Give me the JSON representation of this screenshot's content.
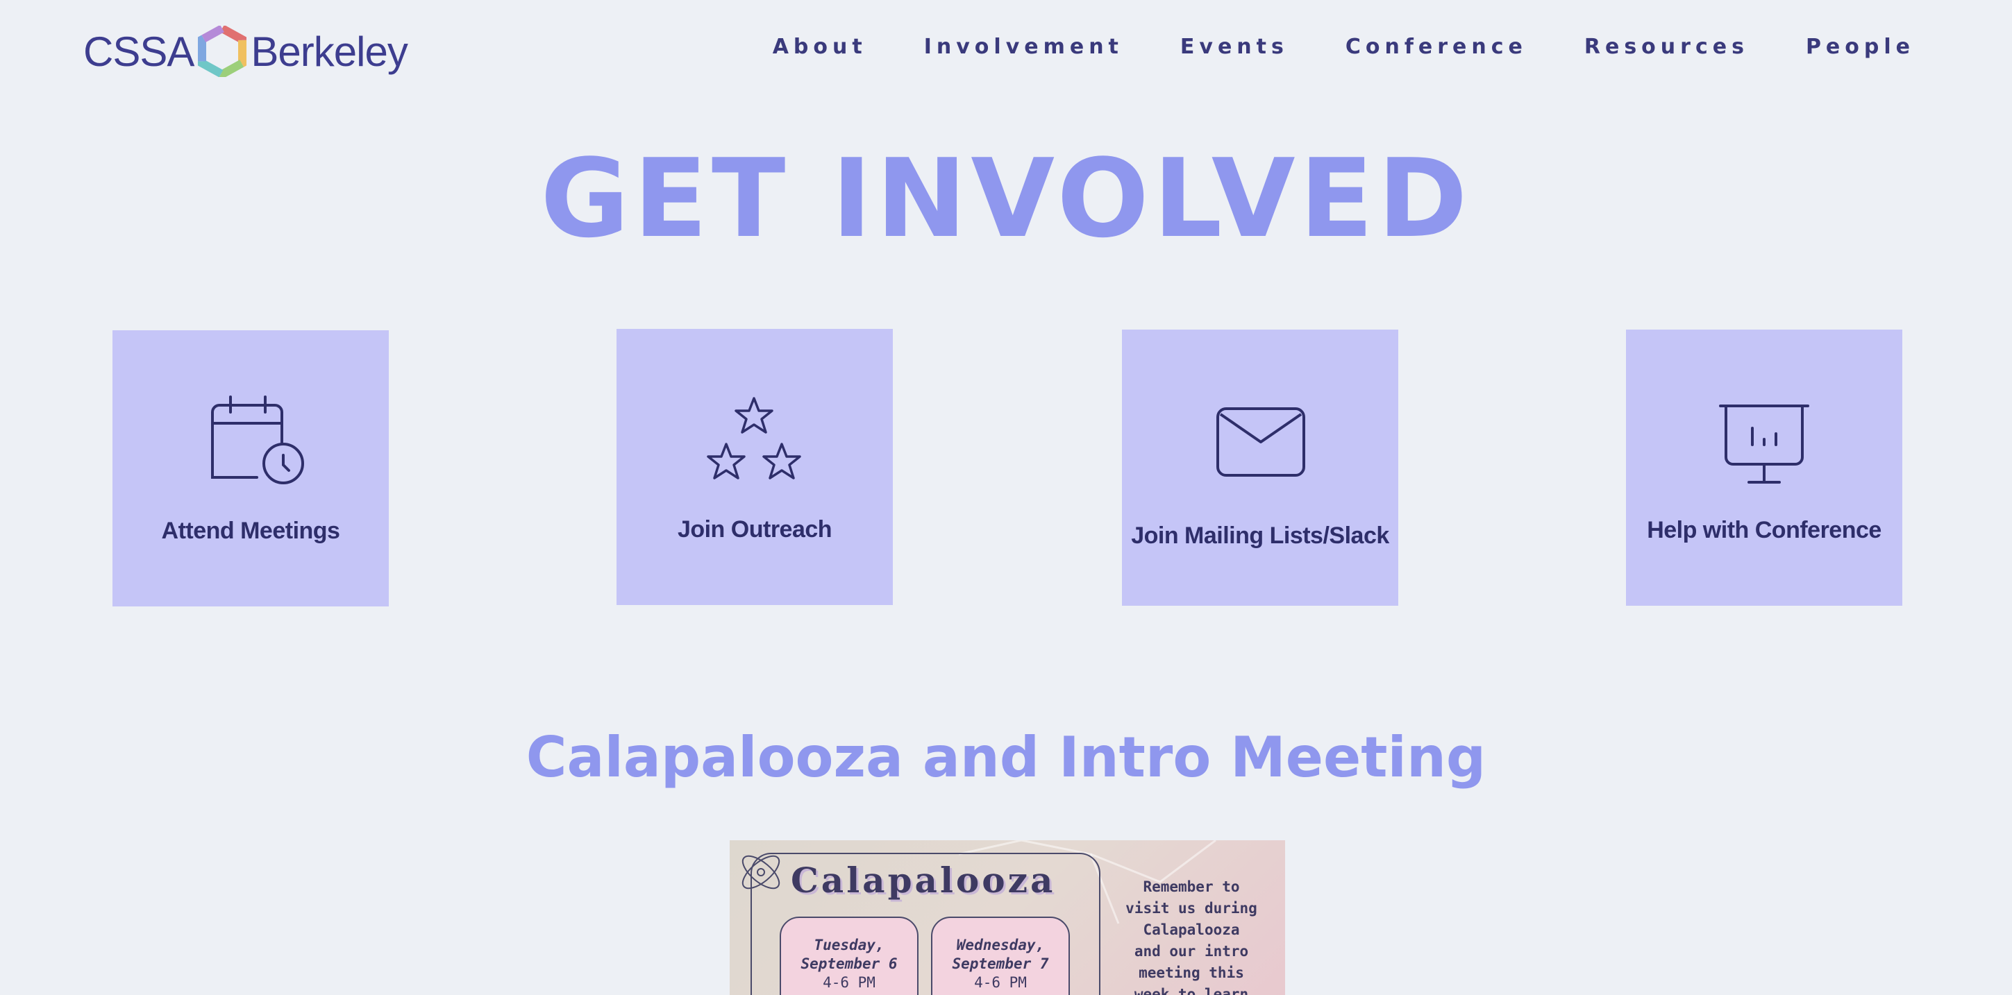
{
  "header": {
    "logo_left": "CSSA",
    "logo_right": "Berkeley",
    "nav": [
      "About",
      "Involvement",
      "Events",
      "Conference",
      "Resources",
      "People"
    ]
  },
  "hero": {
    "title": "GET INVOLVED"
  },
  "cards": [
    {
      "label": "Attend Meetings",
      "icon": "calendar-clock-icon"
    },
    {
      "label": "Join Outreach",
      "icon": "stars-icon"
    },
    {
      "label": "Join Mailing Lists/Slack",
      "icon": "envelope-icon"
    },
    {
      "label": "Help with Conference",
      "icon": "presentation-board-icon"
    }
  ],
  "section": {
    "title": "Calapalooza and Intro Meeting"
  },
  "poster": {
    "title": "Calapalooza",
    "day1": {
      "day": "Tuesday,",
      "date": "September 6",
      "time": "4-6 PM"
    },
    "day2": {
      "day": "Wednesday,",
      "date": "September 7",
      "time": "4-6 PM"
    },
    "side_text": "Remember to\nvisit us during\nCalapalooza\nand our intro\nmeeting this\nweek to learn"
  },
  "colors": {
    "background": "#edf0f5",
    "accent": "#8f97ee",
    "card": "#c5c5f7",
    "text": "#3a3a7c"
  }
}
